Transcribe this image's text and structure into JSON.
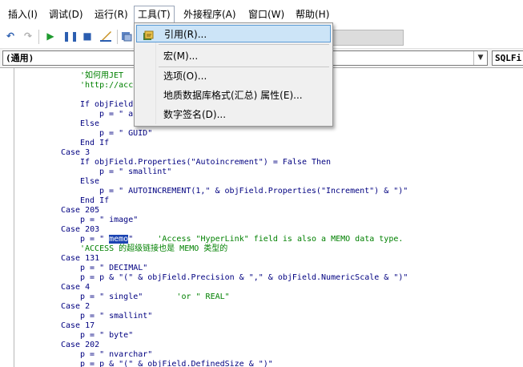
{
  "menubar": {
    "items": [
      {
        "label": "插入(I)"
      },
      {
        "label": "调试(D)"
      },
      {
        "label": "运行(R)"
      },
      {
        "label": "工具(T)"
      },
      {
        "label": "外接程序(A)"
      },
      {
        "label": "窗口(W)"
      },
      {
        "label": "帮助(H)"
      }
    ]
  },
  "tools_menu": {
    "items": [
      {
        "label": "引用(R)...",
        "icon": "references-icon"
      },
      {
        "label": "宏(M)..."
      },
      {
        "label": "选项(O)..."
      },
      {
        "label": "地质数据库格式(汇总) 属性(E)..."
      },
      {
        "label": "数字签名(D)..."
      }
    ]
  },
  "code_window": {
    "object_combo": "(通用)",
    "proc_combo": "SQLFi",
    "lines": [
      {
        "code": "",
        "comment": "'如何用JET"
      },
      {
        "code": "",
        "comment": "'http://acc"
      },
      {
        "code": "If objField"
      },
      {
        "code": "p = \" a"
      },
      {
        "code": "Else"
      },
      {
        "code": "p = \" GUID\""
      },
      {
        "code": "End If"
      },
      {
        "code": "Case 3"
      },
      {
        "code": "If objField.Properties(\"Autoincrement\") = False Then"
      },
      {
        "code": "p = \" smallint\""
      },
      {
        "code": "Else"
      },
      {
        "code": "p = \" AUTOINCREMENT(1,\" & objField.Properties(\"Increment\") & \")\""
      },
      {
        "code": "End If"
      },
      {
        "code": "Case 205"
      },
      {
        "code": "p = \" image\""
      },
      {
        "code": "Case 203"
      },
      {
        "code_pre": "p = \" ",
        "selected": "memo",
        "code_post": "\"     ",
        "comment": "'Access \"HyperLink\" field is also a MEMO data type."
      },
      {
        "code": "",
        "comment": "'ACCESS 的超级链接也是 MEMO 类型的"
      },
      {
        "code": "Case 131"
      },
      {
        "code": "p = \" DECIMAL\""
      },
      {
        "code": "p = p & \"(\" & objField.Precision & \",\" & objField.NumericScale & \")\""
      },
      {
        "code": "Case 4"
      },
      {
        "code": "p = \" single\"       ",
        "comment": "'or \" REAL\""
      },
      {
        "code": "Case 2"
      },
      {
        "code": "p = \" smallint\""
      },
      {
        "code": "Case 17"
      },
      {
        "code": "p = \" byte\""
      },
      {
        "code": "Case 202"
      },
      {
        "code": "p = \" nvarchar\""
      },
      {
        "code": "p = p & \"(\" & objField.DefinedSize & \")\""
      }
    ]
  },
  "colors": {
    "keyword": "#000080",
    "comment": "#008000",
    "selection": "#1c44b2",
    "menu_highlight": "#cce4f7"
  }
}
